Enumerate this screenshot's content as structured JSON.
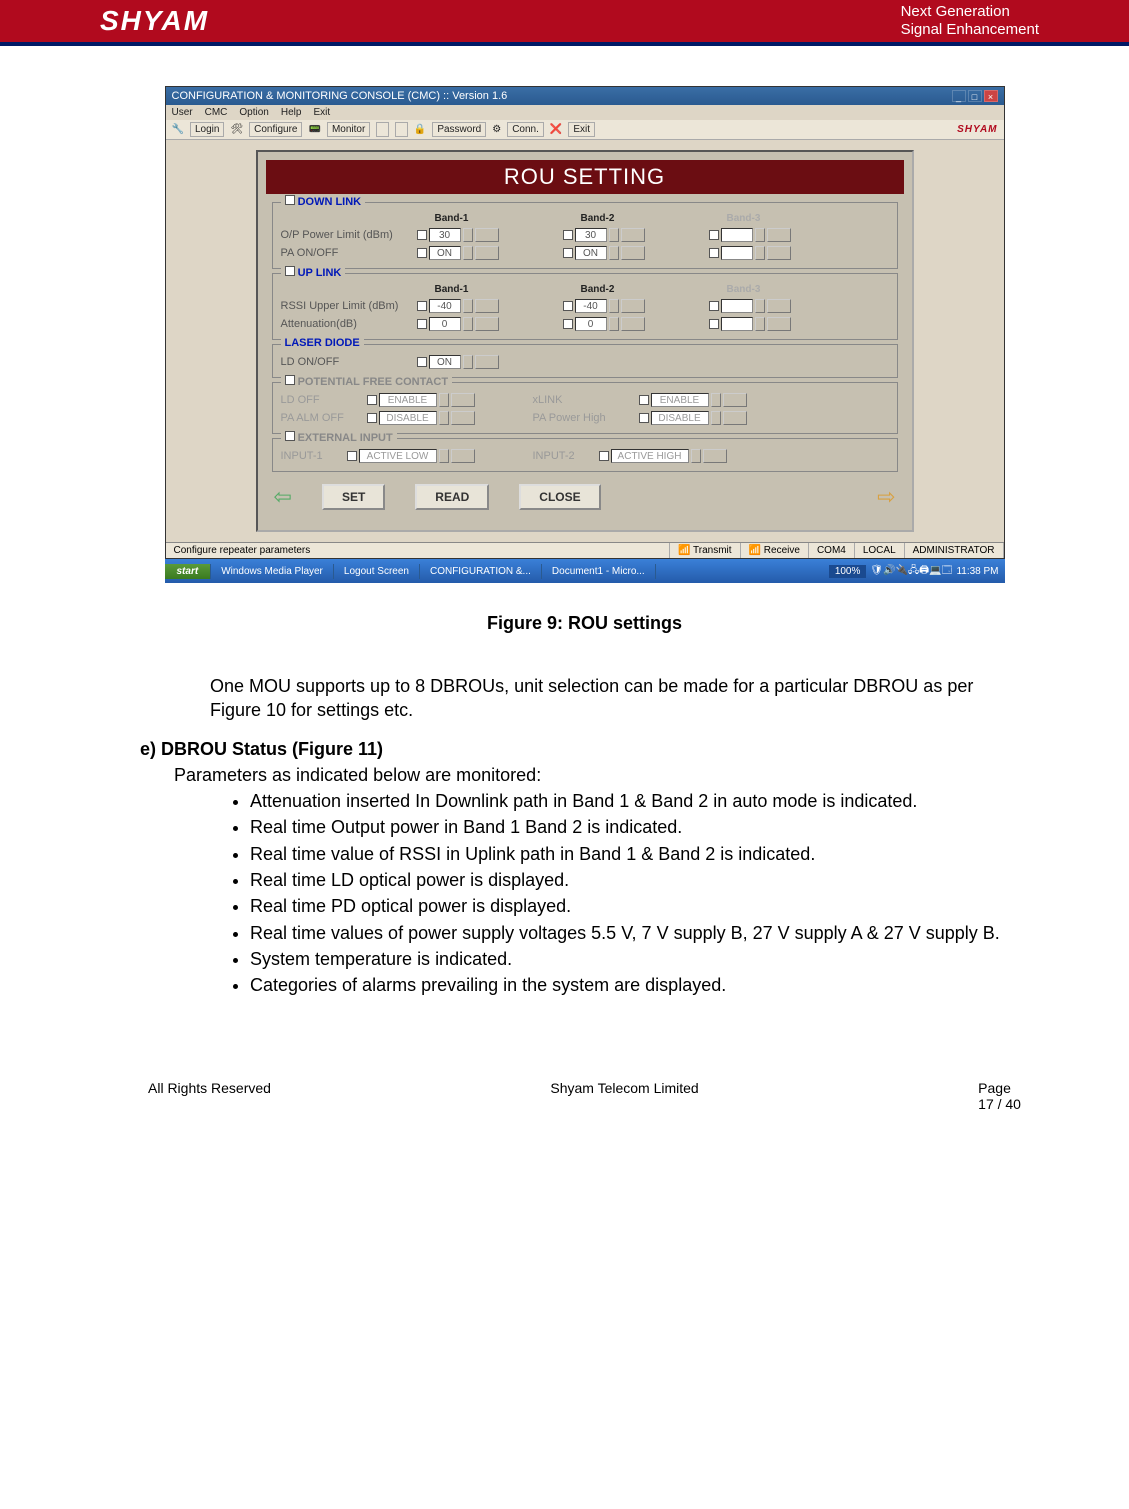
{
  "header": {
    "logo": "SHYAM",
    "line1": "Next Generation",
    "line2": "Signal Enhancement"
  },
  "window": {
    "title": "CONFIGURATION & MONITORING CONSOLE (CMC) :: Version 1.6",
    "menu": [
      "User",
      "CMC",
      "Option",
      "Help",
      "Exit"
    ],
    "toolbar": {
      "login": "Login",
      "configure": "Configure",
      "monitor": "Monitor",
      "password": "Password",
      "conn": "Conn.",
      "exit": "Exit",
      "brand": "SHYAM"
    },
    "status": {
      "left": "Configure repeater parameters",
      "tx": "Transmit",
      "rx": "Receive",
      "port": "COM4",
      "mode": "LOCAL",
      "user": "ADMINISTRATOR"
    }
  },
  "taskbar": {
    "start": "start",
    "items": [
      "Windows Media Player",
      "Logout Screen",
      "CONFIGURATION &...",
      "Document1 - Micro..."
    ],
    "pct": "100%",
    "time": "11:38 PM"
  },
  "panel": {
    "title": "ROU SETTING",
    "downlink": {
      "legend": "DOWN LINK",
      "bands": [
        "Band-1",
        "Band-2",
        "Band-3"
      ],
      "rows": [
        {
          "label": "O/P Power Limit (dBm)",
          "v1": "30",
          "v2": "30",
          "v3": ""
        },
        {
          "label": "PA ON/OFF",
          "v1": "ON",
          "v2": "ON",
          "v3": ""
        }
      ]
    },
    "uplink": {
      "legend": "UP LINK",
      "bands": [
        "Band-1",
        "Band-2",
        "Band-3"
      ],
      "rows": [
        {
          "label": "RSSI Upper Limit (dBm)",
          "v1": "-40",
          "v2": "-40",
          "v3": ""
        },
        {
          "label": "Attenuation(dB)",
          "v1": "0",
          "v2": "0",
          "v3": ""
        }
      ]
    },
    "laser": {
      "legend": "LASER DIODE",
      "label": "LD ON/OFF",
      "v": "ON"
    },
    "pfc": {
      "legend": "POTENTIAL FREE CONTACT",
      "r1l": "LD OFF",
      "r1a": "ENABLE",
      "r1r": "xLINK",
      "r1b": "ENABLE",
      "r2l": "PA ALM OFF",
      "r2a": "DISABLE",
      "r2r": "PA Power High",
      "r2b": "DISABLE"
    },
    "ext": {
      "legend": "EXTERNAL INPUT",
      "l1": "INPUT-1",
      "v1": "ACTIVE LOW",
      "l2": "INPUT-2",
      "v2": "ACTIVE HIGH"
    },
    "buttons": {
      "set": "SET",
      "read": "READ",
      "close": "CLOSE"
    }
  },
  "doc": {
    "fig_caption": "Figure 9: ROU settings",
    "para1": "One MOU supports up to 8 DBROUs, unit selection can be made for a particular DBROU as per Figure 10 for settings etc.",
    "section_e_title": "e) DBROU Status (Figure 11)",
    "section_e_intro": "Parameters as indicated below are monitored:",
    "bullets": [
      "Attenuation inserted In Downlink path in Band 1 & Band 2 in auto mode is indicated.",
      "Real time Output power in Band 1 Band 2 is indicated.",
      "Real time value of RSSI in Uplink path in Band 1 & Band 2 is indicated.",
      "Real time LD optical power is displayed.",
      "Real time PD optical power is displayed.",
      "Real time values of power supply voltages 5.5 V, 7 V supply B, 27 V supply A & 27 V supply B.",
      "System temperature is indicated.",
      "Categories of alarms prevailing in the system are displayed."
    ]
  },
  "footer": {
    "left": "All Rights Reserved",
    "center": "Shyam Telecom Limited",
    "right_label": "Page",
    "right_num": "17 / 40"
  }
}
